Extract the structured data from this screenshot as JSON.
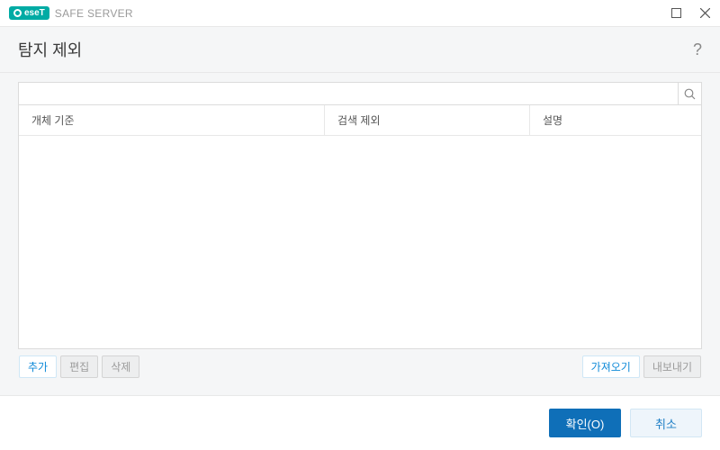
{
  "titlebar": {
    "brand": "eseT",
    "product": "SAFE SERVER"
  },
  "header": {
    "title": "탐지 제외",
    "help": "?"
  },
  "search": {
    "value": "",
    "placeholder": ""
  },
  "table": {
    "columns": [
      "개체 기준",
      "검색 제외",
      "설명"
    ],
    "rows": []
  },
  "toolbar": {
    "add": "추가",
    "edit": "편집",
    "delete": "삭제",
    "import": "가져오기",
    "export": "내보내기"
  },
  "footer": {
    "ok": "확인(O)",
    "cancel": "취소"
  }
}
